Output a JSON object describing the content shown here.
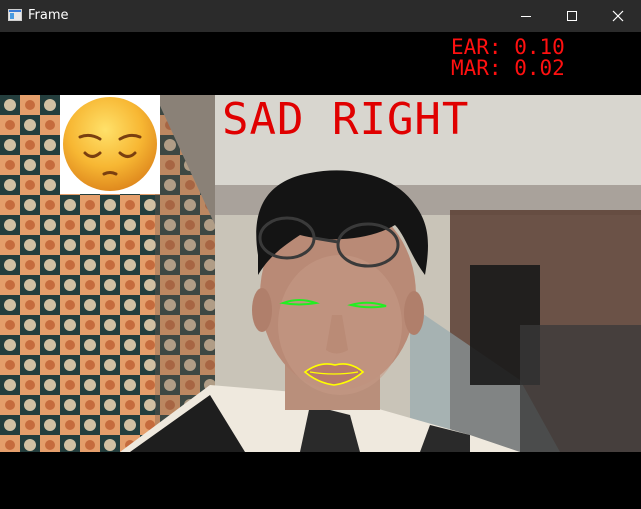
{
  "window": {
    "title": "Frame",
    "icons": {
      "app": "window-app-icon",
      "minimize": "minimize-icon",
      "maximize": "maximize-icon",
      "close": "close-icon"
    }
  },
  "metrics": {
    "ear_text": "EAR: 0.10",
    "mar_text": "MAR: 0.02",
    "color": "#ff1010"
  },
  "emotion": {
    "label": "SAD RIGHT",
    "color": "#e00000",
    "emoji": "pensive-face-emoji"
  },
  "landmarks": {
    "eyes_color": "#22ee22",
    "mouth_color": "#ffff00"
  }
}
